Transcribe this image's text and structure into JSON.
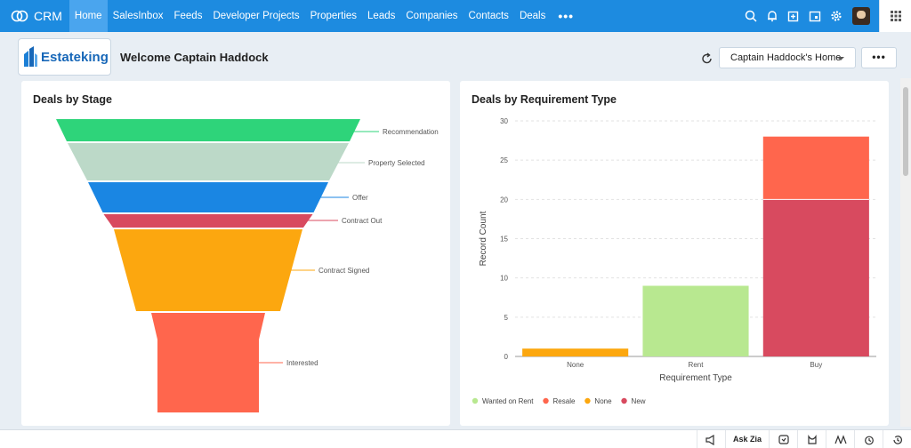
{
  "app": {
    "name": "CRM"
  },
  "nav": {
    "items": [
      {
        "label": "Home",
        "active": true
      },
      {
        "label": "SalesInbox"
      },
      {
        "label": "Feeds"
      },
      {
        "label": "Developer Projects"
      },
      {
        "label": "Properties"
      },
      {
        "label": "Leads"
      },
      {
        "label": "Companies"
      },
      {
        "label": "Contacts"
      },
      {
        "label": "Deals"
      }
    ],
    "more_label": "•••"
  },
  "header": {
    "logo_text": "Estateking",
    "welcome": "Welcome Captain Haddock",
    "home_select": "Captain Haddock's Home",
    "more_label": "•••"
  },
  "bottom": {
    "ask_zia": "Ask Zia"
  },
  "funnel_card": {
    "title": "Deals by Stage",
    "stages": [
      {
        "label": "Recommendation",
        "color": "#2ed47a"
      },
      {
        "label": "Property Selected",
        "color": "#bcd9c8"
      },
      {
        "label": "Offer",
        "color": "#1a86e3"
      },
      {
        "label": "Contract Out",
        "color": "#d84a5f"
      },
      {
        "label": "Contract Signed",
        "color": "#fca70f"
      },
      {
        "label": "Interested",
        "color": "#ff664d"
      }
    ]
  },
  "chart_data": {
    "type": "bar",
    "stacked": true,
    "title": "Deals by Requirement Type",
    "xlabel": "Requirement Type",
    "ylabel": "Record Count",
    "categories": [
      "None",
      "Rent",
      "Buy"
    ],
    "ylim": [
      0,
      30
    ],
    "yticks": [
      0,
      5,
      10,
      15,
      20,
      25,
      30
    ],
    "grid": true,
    "legend_position": "bottom-left",
    "series": [
      {
        "name": "Wanted on Rent",
        "color": "#b8e890",
        "values": [
          0,
          9,
          0
        ]
      },
      {
        "name": "Resale",
        "color": "#ff664d",
        "values": [
          0,
          0,
          8
        ]
      },
      {
        "name": "None",
        "color": "#fca70f",
        "values": [
          1,
          0,
          0
        ]
      },
      {
        "name": "New",
        "color": "#d84a5f",
        "values": [
          0,
          0,
          20
        ]
      }
    ]
  }
}
